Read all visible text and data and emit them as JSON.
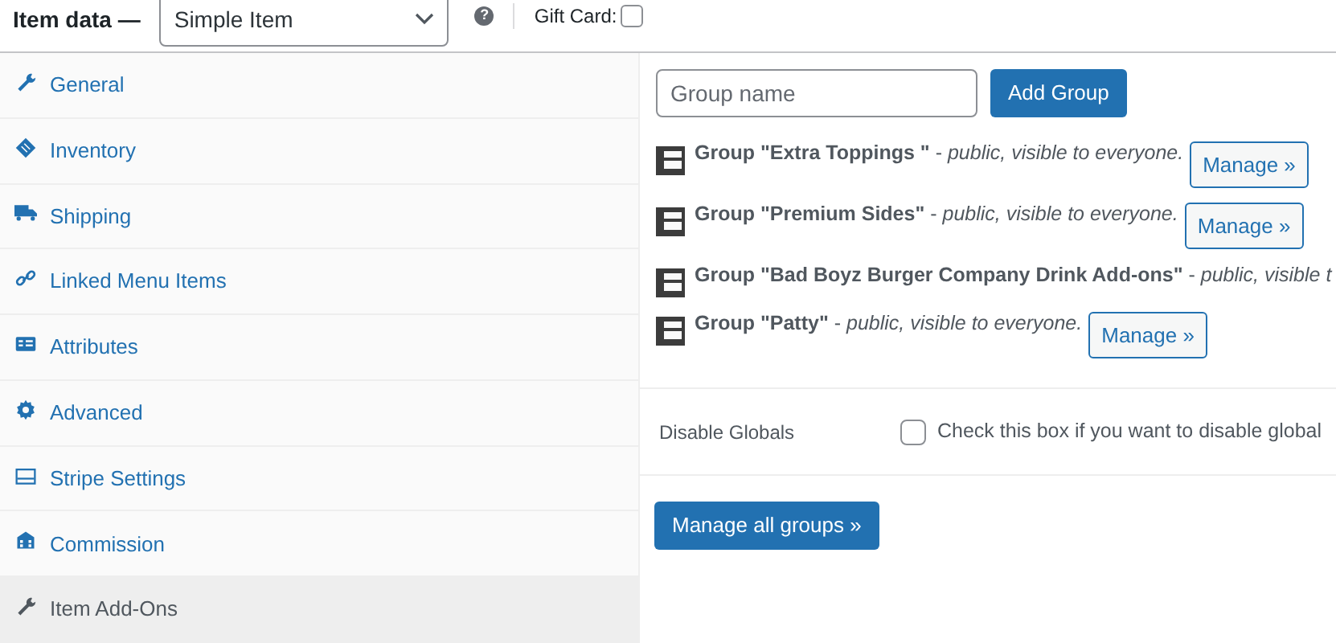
{
  "header": {
    "title": "Item data —",
    "type_select": "Simple Item",
    "help": "?",
    "gift_card": {
      "label": "Gift Card:",
      "checked": false
    }
  },
  "sidebar": {
    "items": [
      {
        "label": "General",
        "selected": false
      },
      {
        "label": "Inventory",
        "selected": false
      },
      {
        "label": "Shipping",
        "selected": false
      },
      {
        "label": "Linked Menu Items",
        "selected": false
      },
      {
        "label": "Attributes",
        "selected": false
      },
      {
        "label": "Advanced",
        "selected": false
      },
      {
        "label": "Stripe Settings",
        "selected": false
      },
      {
        "label": "Commission",
        "selected": false
      },
      {
        "label": "Item Add-Ons",
        "selected": true
      }
    ]
  },
  "group_name_field": {
    "placeholder": "Group name"
  },
  "add_group_button": "Add Group",
  "groups": [
    {
      "text": "**Group \"Extra Toppings \"** - *public, visible to everyone.*",
      "manage_button": "Manage »"
    },
    {
      "text": "**Group \"Premium Sides\"** - *public, visible to everyone.*",
      "manage_button": "Manage »"
    },
    {
      "text": "**Group \"Bad Boyz Burger Company Drink Add-ons\"** - *public, visible t*"
    },
    {
      "text": "**Group \"Patty\"** - *public, visible to everyone.*",
      "manage_button": "Manage »"
    }
  ],
  "disable_globals": {
    "label": "Disable Globals",
    "checked": false,
    "description": "Check this box if you want to disable global"
  },
  "manage_all_button": "Manage all groups »"
}
